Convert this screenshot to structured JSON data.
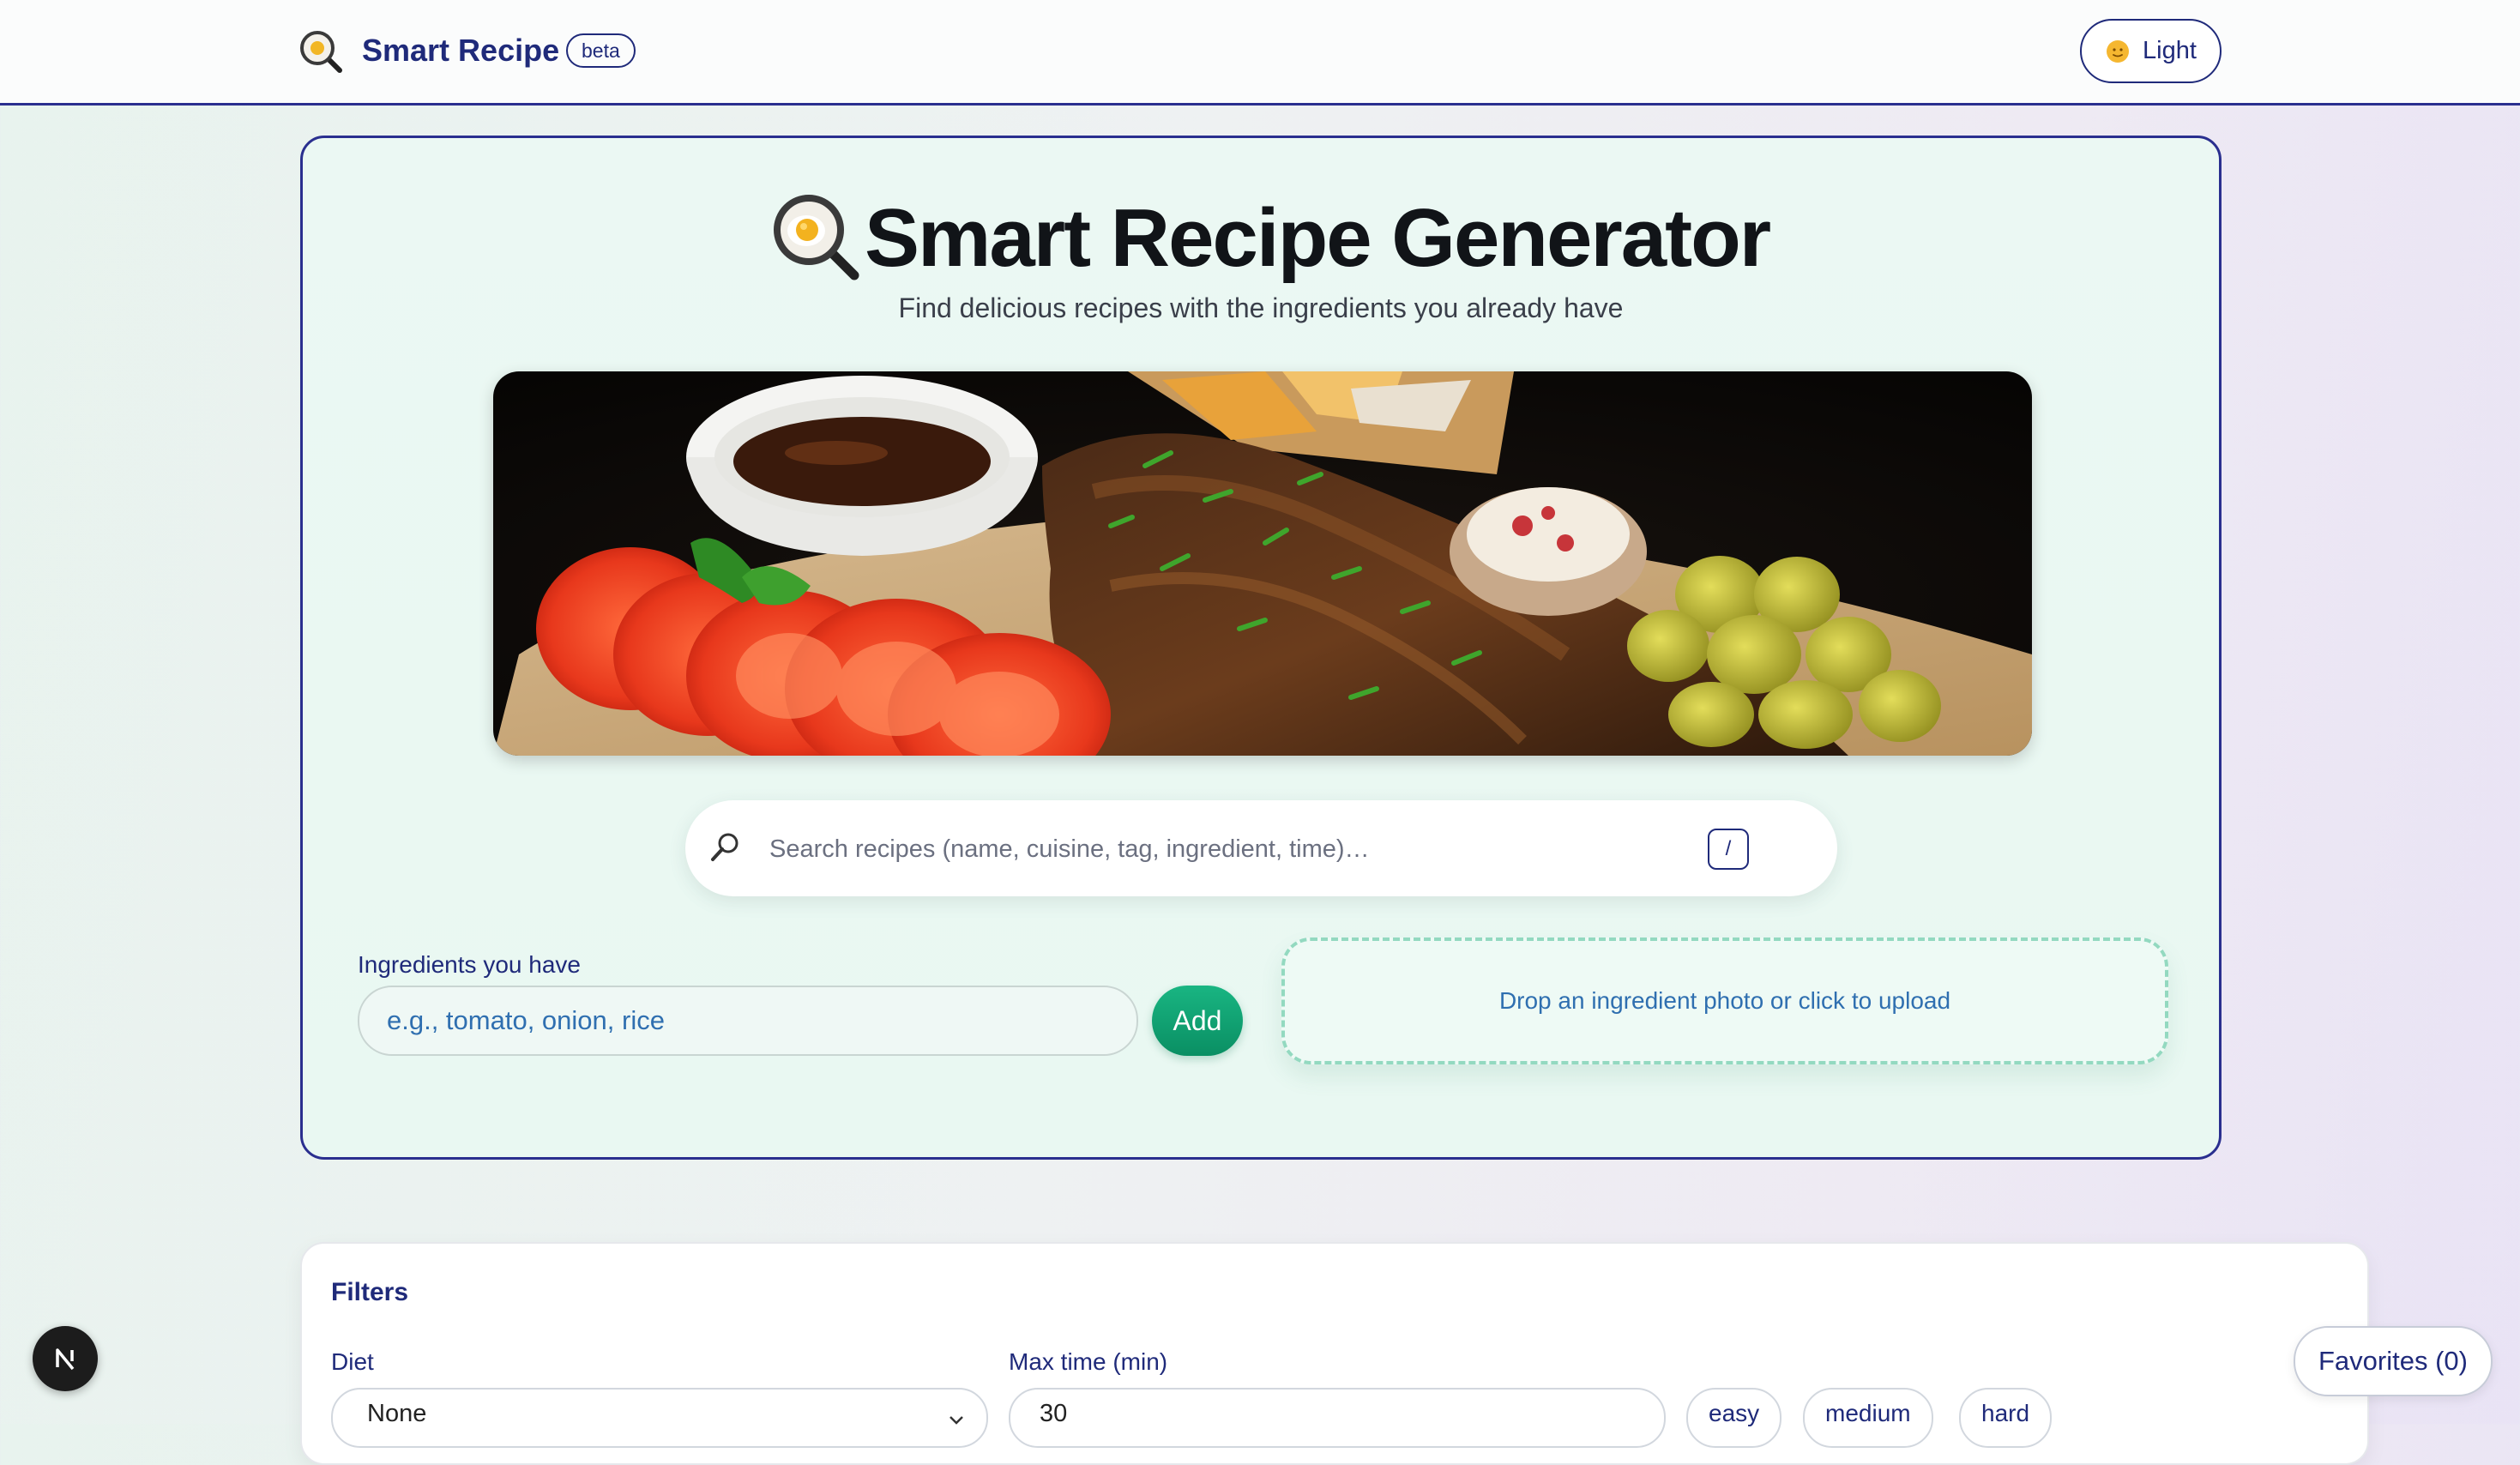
{
  "header": {
    "brand_name": "Smart Recipe",
    "beta_label": "beta",
    "theme_toggle_label": "Light",
    "brand_icon": "magnifier-egg-icon",
    "theme_icon": "sun-face-icon"
  },
  "hero": {
    "title": "Smart Recipe Generator",
    "subtitle": "Find delicious recipes with the ingredients you already have",
    "title_icon": "magnifier-egg-icon",
    "image": "grilled-ribs-platter-photo"
  },
  "search": {
    "placeholder": "Search recipes (name, cuisine, tag, ingredient, time)…",
    "value": "",
    "shortcut_key": "/",
    "icon": "search-icon"
  },
  "ingredients": {
    "label": "Ingredients you have",
    "placeholder": "e.g., tomato, onion, rice",
    "value": "",
    "add_label": "Add"
  },
  "dropzone": {
    "text": "Drop an ingredient photo or click to upload"
  },
  "filters": {
    "title": "Filters",
    "diet_label": "Diet",
    "diet_value": "None",
    "max_time_label": "Max time (min)",
    "max_time_value": "30",
    "difficulty_chips": [
      "easy",
      "medium",
      "hard"
    ]
  },
  "floating": {
    "next_badge": "N",
    "favorites_label": "Favorites (0)"
  },
  "colors": {
    "accent": "#1f2a7a",
    "add_button": "#10a472",
    "dropzone_border": "#93d9c0",
    "hero_background": "#ebf8f3"
  }
}
